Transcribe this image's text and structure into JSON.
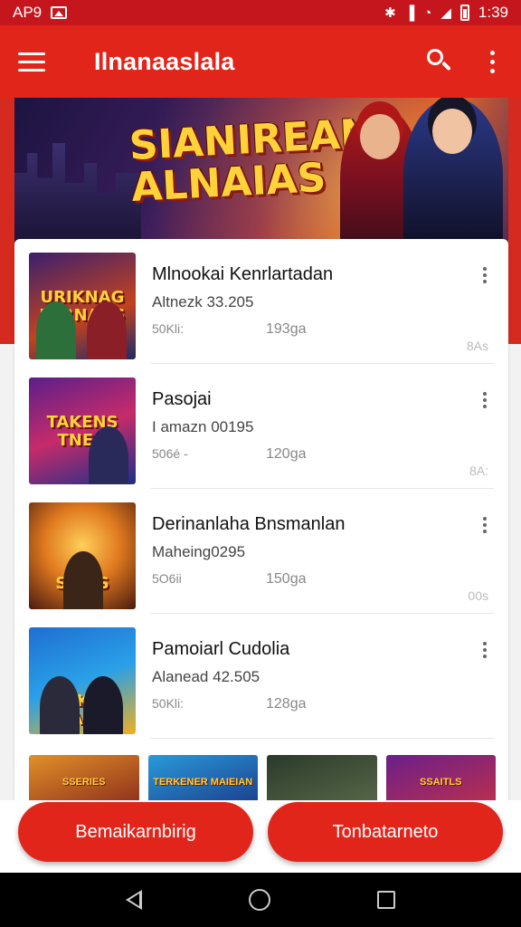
{
  "status_bar": {
    "carrier": "AP9",
    "time": "1:39",
    "icons": [
      "image-icon",
      "bluetooth-icon",
      "vibrate-icon",
      "wifi-icon",
      "signal-icon",
      "battery-icon"
    ]
  },
  "app_bar": {
    "title": "Ilnanaaslala",
    "icons": [
      "menu-icon",
      "search-icon",
      "more-vert-icon"
    ]
  },
  "banner": {
    "title_line1": "SIANIREAN",
    "title_line2": "ALNAIAS"
  },
  "list": {
    "items": [
      {
        "title": "Mlnookai Kenrlartadan",
        "subtitle": "Altnezk 33.205",
        "meta1": "50Kli:",
        "meta2": "193ga",
        "meta3": "8As",
        "thumb_text": "URIKNAG FARNANS"
      },
      {
        "title": "Pasojai",
        "subtitle": "I amazn 00195",
        "meta1": "506é -",
        "meta2": "120ga",
        "meta3": "8A:",
        "thumb_text": "TAKENS TNEO"
      },
      {
        "title": "Derinanlaha Bnsmanlan",
        "subtitle": "Maheing0295",
        "meta1": "5O6ii",
        "meta2": "150ga",
        "meta3": "00s",
        "thumb_text": "STIUS"
      },
      {
        "title": "Pamoiarl Cudolia",
        "subtitle": "Alanead 42.505",
        "meta1": "50Kli:",
        "meta2": "128ga",
        "meta3": "",
        "thumb_text": "SLIKNG GANE"
      }
    ]
  },
  "strip": {
    "tiles": [
      "SSERIES",
      "TERKENER MAIEIAN",
      "",
      "SSAITLS"
    ]
  },
  "actions": {
    "left_label": "Bemaikarnbirig",
    "right_label": "Tonbatarneto"
  },
  "nav_bar": {
    "icons": [
      "back-icon",
      "home-icon",
      "recent-apps-icon"
    ]
  },
  "colors": {
    "primary": "#e1251b",
    "status_bar": "#c4161c",
    "nav_bar": "#000000"
  }
}
